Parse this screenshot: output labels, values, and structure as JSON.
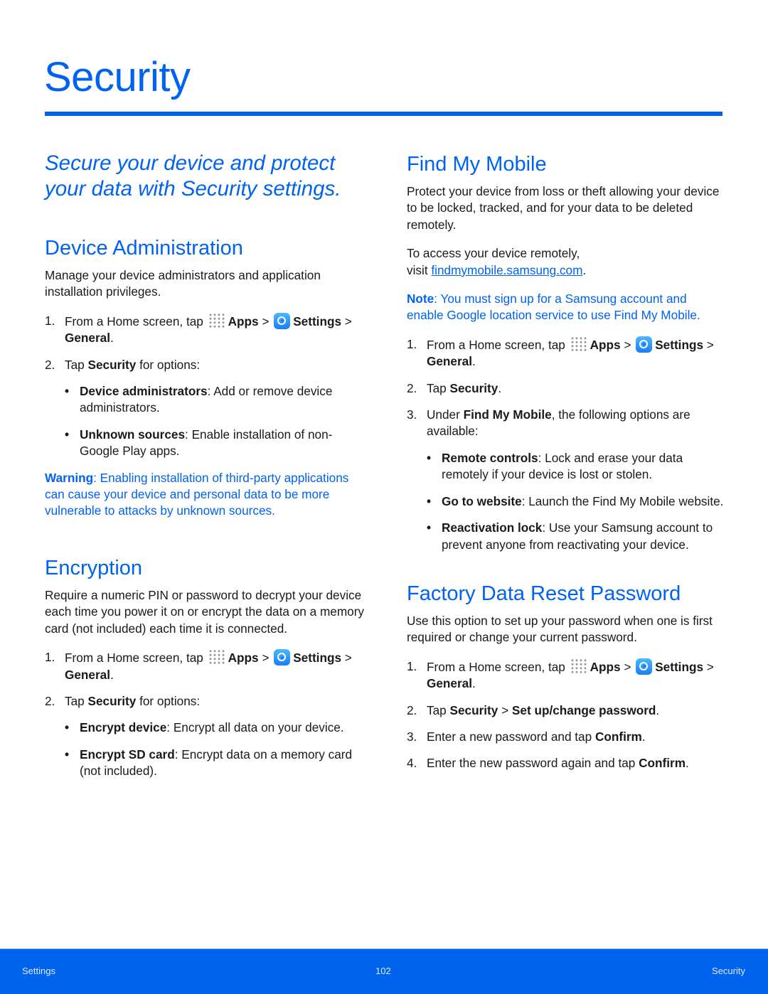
{
  "page": {
    "title": "Security",
    "intro": "Secure your device and protect your data with Security settings."
  },
  "device_admin": {
    "heading": "Device Administration",
    "description": "Manage your device administrators and application installation privileges.",
    "steps": [
      {
        "num": "1.",
        "segments": [
          {
            "t": "From a Home screen, tap ",
            "b": false
          },
          {
            "icon": "apps-icon"
          },
          {
            "t": "Apps",
            "b": true
          },
          {
            "t": " > ",
            "b": false
          },
          {
            "icon": "settings-icon"
          },
          {
            "t": "Settings",
            "b": true
          },
          {
            "t": " > ",
            "b": false
          },
          {
            "t": "General",
            "b": true
          },
          {
            "t": ".",
            "b": false
          }
        ]
      },
      {
        "num": "2.",
        "segments": [
          {
            "t": "Tap ",
            "b": false
          },
          {
            "t": "Security",
            "b": true
          },
          {
            "t": " for options:",
            "b": false
          }
        ]
      }
    ],
    "options": [
      {
        "term": "Device administrators",
        "desc": ": Add or remove device administrators."
      },
      {
        "term": "Unknown sources",
        "desc": ": Enable installation of non-Google Play apps."
      }
    ],
    "warning": {
      "label": "Warning",
      "text": ": Enabling installation of third-party applications can cause your device and personal data to be more vulnerable to attacks by unknown sources."
    }
  },
  "encryption": {
    "heading": "Encryption",
    "description": "Require a numeric PIN or password to decrypt your device each time you power it on or encrypt the data on a memory card (not included) each time it is connected.",
    "steps": [
      {
        "num": "1.",
        "segments": [
          {
            "t": "From a Home screen, tap ",
            "b": false
          },
          {
            "icon": "apps-icon"
          },
          {
            "t": "Apps",
            "b": true
          },
          {
            "t": " > ",
            "b": false
          },
          {
            "icon": "settings-icon"
          },
          {
            "t": "Settings",
            "b": true
          },
          {
            "t": " > ",
            "b": false
          },
          {
            "t": "General",
            "b": true
          },
          {
            "t": ".",
            "b": false
          }
        ]
      },
      {
        "num": "2.",
        "segments": [
          {
            "t": "Tap ",
            "b": false
          },
          {
            "t": "Security",
            "b": true
          },
          {
            "t": " for options:",
            "b": false
          }
        ]
      }
    ],
    "options": [
      {
        "term": "Encrypt device",
        "desc": ": Encrypt all data on your device."
      },
      {
        "term": "Encrypt SD card",
        "desc": ": Encrypt data on a memory card (not included)."
      }
    ]
  },
  "find_my_mobile": {
    "heading": "Find My Mobile",
    "description": "Protect your device from loss or theft allowing your device to be locked, tracked, and for your data to be deleted remotely.",
    "access_text": "To access your device remotely,",
    "visit_text": "visit ",
    "link_text": "findmymobile.samsung.com",
    "link_suffix": ".",
    "note": {
      "label": "Note",
      "text": ": You must sign up for a Samsung account and enable Google location service to use Find My Mobile."
    },
    "steps": [
      {
        "num": "1.",
        "segments": [
          {
            "t": "From a Home screen, tap ",
            "b": false
          },
          {
            "icon": "apps-icon"
          },
          {
            "t": "Apps",
            "b": true
          },
          {
            "t": " > ",
            "b": false
          },
          {
            "icon": "settings-icon"
          },
          {
            "t": "Settings",
            "b": true
          },
          {
            "t": " > ",
            "b": false
          },
          {
            "t": "General",
            "b": true
          },
          {
            "t": ".",
            "b": false
          }
        ]
      },
      {
        "num": "2.",
        "segments": [
          {
            "t": "Tap ",
            "b": false
          },
          {
            "t": "Security",
            "b": true
          },
          {
            "t": ".",
            "b": false
          }
        ]
      },
      {
        "num": "3.",
        "segments": [
          {
            "t": "Under ",
            "b": false
          },
          {
            "t": "Find My Mobile",
            "b": true
          },
          {
            "t": ", the following options are available:",
            "b": false
          }
        ]
      }
    ],
    "options": [
      {
        "term": "Remote controls",
        "desc": ": Lock and erase your data remotely if your device is lost or stolen."
      },
      {
        "term": "Go to website",
        "desc": ": Launch the Find My Mobile website."
      },
      {
        "term": "Reactivation lock",
        "desc": ": Use your Samsung account to prevent anyone from reactivating your device."
      }
    ]
  },
  "factory_reset": {
    "heading": "Factory Data Reset Password",
    "description": "Use this option to set up your password when one is first required or change your current password.",
    "steps": [
      {
        "num": "1.",
        "segments": [
          {
            "t": "From a Home screen, tap ",
            "b": false
          },
          {
            "icon": "apps-icon"
          },
          {
            "t": "Apps",
            "b": true
          },
          {
            "t": " > ",
            "b": false
          },
          {
            "icon": "settings-icon"
          },
          {
            "t": "Settings",
            "b": true
          },
          {
            "t": " > ",
            "b": false
          },
          {
            "t": "General",
            "b": true
          },
          {
            "t": ".",
            "b": false
          }
        ]
      },
      {
        "num": "2.",
        "segments": [
          {
            "t": "Tap ",
            "b": false
          },
          {
            "t": "Security",
            "b": true
          },
          {
            "t": " > ",
            "b": false
          },
          {
            "t": "Set up/change password",
            "b": true
          },
          {
            "t": ".",
            "b": false
          }
        ]
      },
      {
        "num": "3.",
        "segments": [
          {
            "t": "Enter a new password and tap ",
            "b": false
          },
          {
            "t": "Confirm",
            "b": true
          },
          {
            "t": ".",
            "b": false
          }
        ]
      },
      {
        "num": "4.",
        "segments": [
          {
            "t": "Enter the new password again and tap ",
            "b": false
          },
          {
            "t": "Confirm",
            "b": true
          },
          {
            "t": ".",
            "b": false
          }
        ]
      }
    ]
  },
  "footer": {
    "left": "Settings",
    "page_number": "102",
    "right": "Security"
  },
  "colors": {
    "accent": "#0063f0",
    "text": "#1a1a1a",
    "footer_bg": "#0063f0"
  }
}
